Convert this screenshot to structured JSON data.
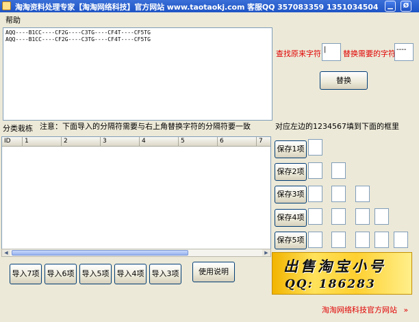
{
  "window": {
    "title": "淘淘资料处理专家【淘淘网络科技】官方网站 www.taotaokj.com 客服QQ 357083359 1351034504",
    "minimize_icon": "minimize-icon",
    "close_symbol": "Ø"
  },
  "menu": {
    "help": "帮助"
  },
  "editor": {
    "text": "AQQ----B1CC----CF2G----C3TG----CF4T----CF5TG\nAQQ----B1CC----CF2G----C3TG----CF4T----CF5TG"
  },
  "replace": {
    "find_label": "查找原来字符",
    "find_value": "|",
    "replace_label": "替换需要的字符",
    "replace_value": "----",
    "button": "替换"
  },
  "info": {
    "classify_label": "分类栽栋",
    "note": "注意：下面导入的分隔符需要与右上角替换字符的分隔符要一致",
    "right_note": "对应左边的1234567填到下面的框里"
  },
  "grid": {
    "columns": [
      "ID",
      "1",
      "2",
      "3",
      "4",
      "5",
      "6",
      "7"
    ]
  },
  "scrollbar": {
    "left_arrow": "◀",
    "right_arrow": "▶"
  },
  "save_buttons": [
    "保存1项",
    "保存2项",
    "保存3项",
    "保存4项",
    "保存5项"
  ],
  "import_buttons": [
    "导入7项",
    "导入6项",
    "导入5项",
    "导入4项",
    "导入3项"
  ],
  "help_button": "使用说明",
  "banner": {
    "line1": "出售淘宝小号",
    "line2": "QQ: 186283"
  },
  "footer": {
    "link": "淘淘网络科技官方网站",
    "chevrons": "»"
  }
}
